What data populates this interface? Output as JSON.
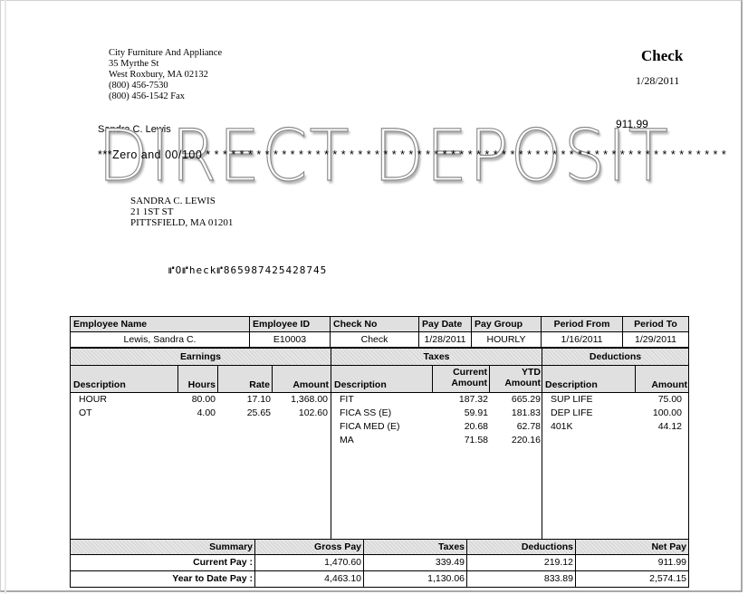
{
  "company": {
    "name": "City Furniture And Appliance",
    "address1": "35 Myrthe St",
    "address2": "West Roxbury, MA  02132",
    "phone": "(800) 456-7530",
    "fax": "(800) 456-1542 Fax"
  },
  "check": {
    "title": "Check",
    "date": "1/28/2011",
    "amount": "911.99",
    "payee": "Sandra C. Lewis",
    "amount_words": "***Zero and 00/100 * * * * * * * * * * * * * * * * * * * * * * * * * * * * * * * * * * * * * * * * * * * * * * * * * * * * * * * * * * * * * *",
    "watermark": "DIRECT DEPOSIT",
    "mail_name": "SANDRA C. LEWIS",
    "mail_street": "21 1ST ST",
    "mail_city": "PITTSFIELD, MA 01201",
    "micr": "⑈O⑈heck⑈865987425428745"
  },
  "info": {
    "headers": [
      "Employee Name",
      "Employee ID",
      "Check No",
      "Pay Date",
      "Pay Group",
      "Period From",
      "Period To"
    ],
    "values": [
      "Lewis, Sandra C.",
      "E10003",
      "Check",
      "1/28/2011",
      "HOURLY",
      "1/16/2011",
      "1/29/2011"
    ]
  },
  "sections": {
    "earnings": "Earnings",
    "taxes": "Taxes",
    "deductions": "Deductions"
  },
  "earnings": {
    "headers": [
      "Description",
      "Hours",
      "Rate",
      "Amount"
    ],
    "rows": [
      [
        "HOUR",
        "80.00",
        "17.10",
        "1,368.00"
      ],
      [
        "OT",
        "4.00",
        "25.65",
        "102.60"
      ]
    ]
  },
  "taxes": {
    "headers": [
      "Description",
      "Current",
      "Amount",
      "YTD",
      "Amount"
    ],
    "rows": [
      [
        "FIT",
        "187.32",
        "665.29"
      ],
      [
        "FICA SS (E)",
        "59.91",
        "181.83"
      ],
      [
        "FICA MED (E)",
        "20.68",
        "62.78"
      ],
      [
        "MA",
        "71.58",
        "220.16"
      ]
    ]
  },
  "deductions": {
    "headers": [
      "Description",
      "Amount"
    ],
    "rows": [
      [
        "SUP LIFE",
        "75.00"
      ],
      [
        "DEP LIFE",
        "100.00"
      ],
      [
        "401K",
        "44.12"
      ]
    ]
  },
  "summary": {
    "headers": [
      "Summary",
      "Gross Pay",
      "Taxes",
      "Deductions",
      "Net Pay"
    ],
    "current": [
      "Current Pay :",
      "1,470.60",
      "339.49",
      "219.12",
      "911.99"
    ],
    "ytd": [
      "Year to Date Pay :",
      "4,463.10",
      "1,130.06",
      "833.89",
      "2,574.15"
    ]
  }
}
